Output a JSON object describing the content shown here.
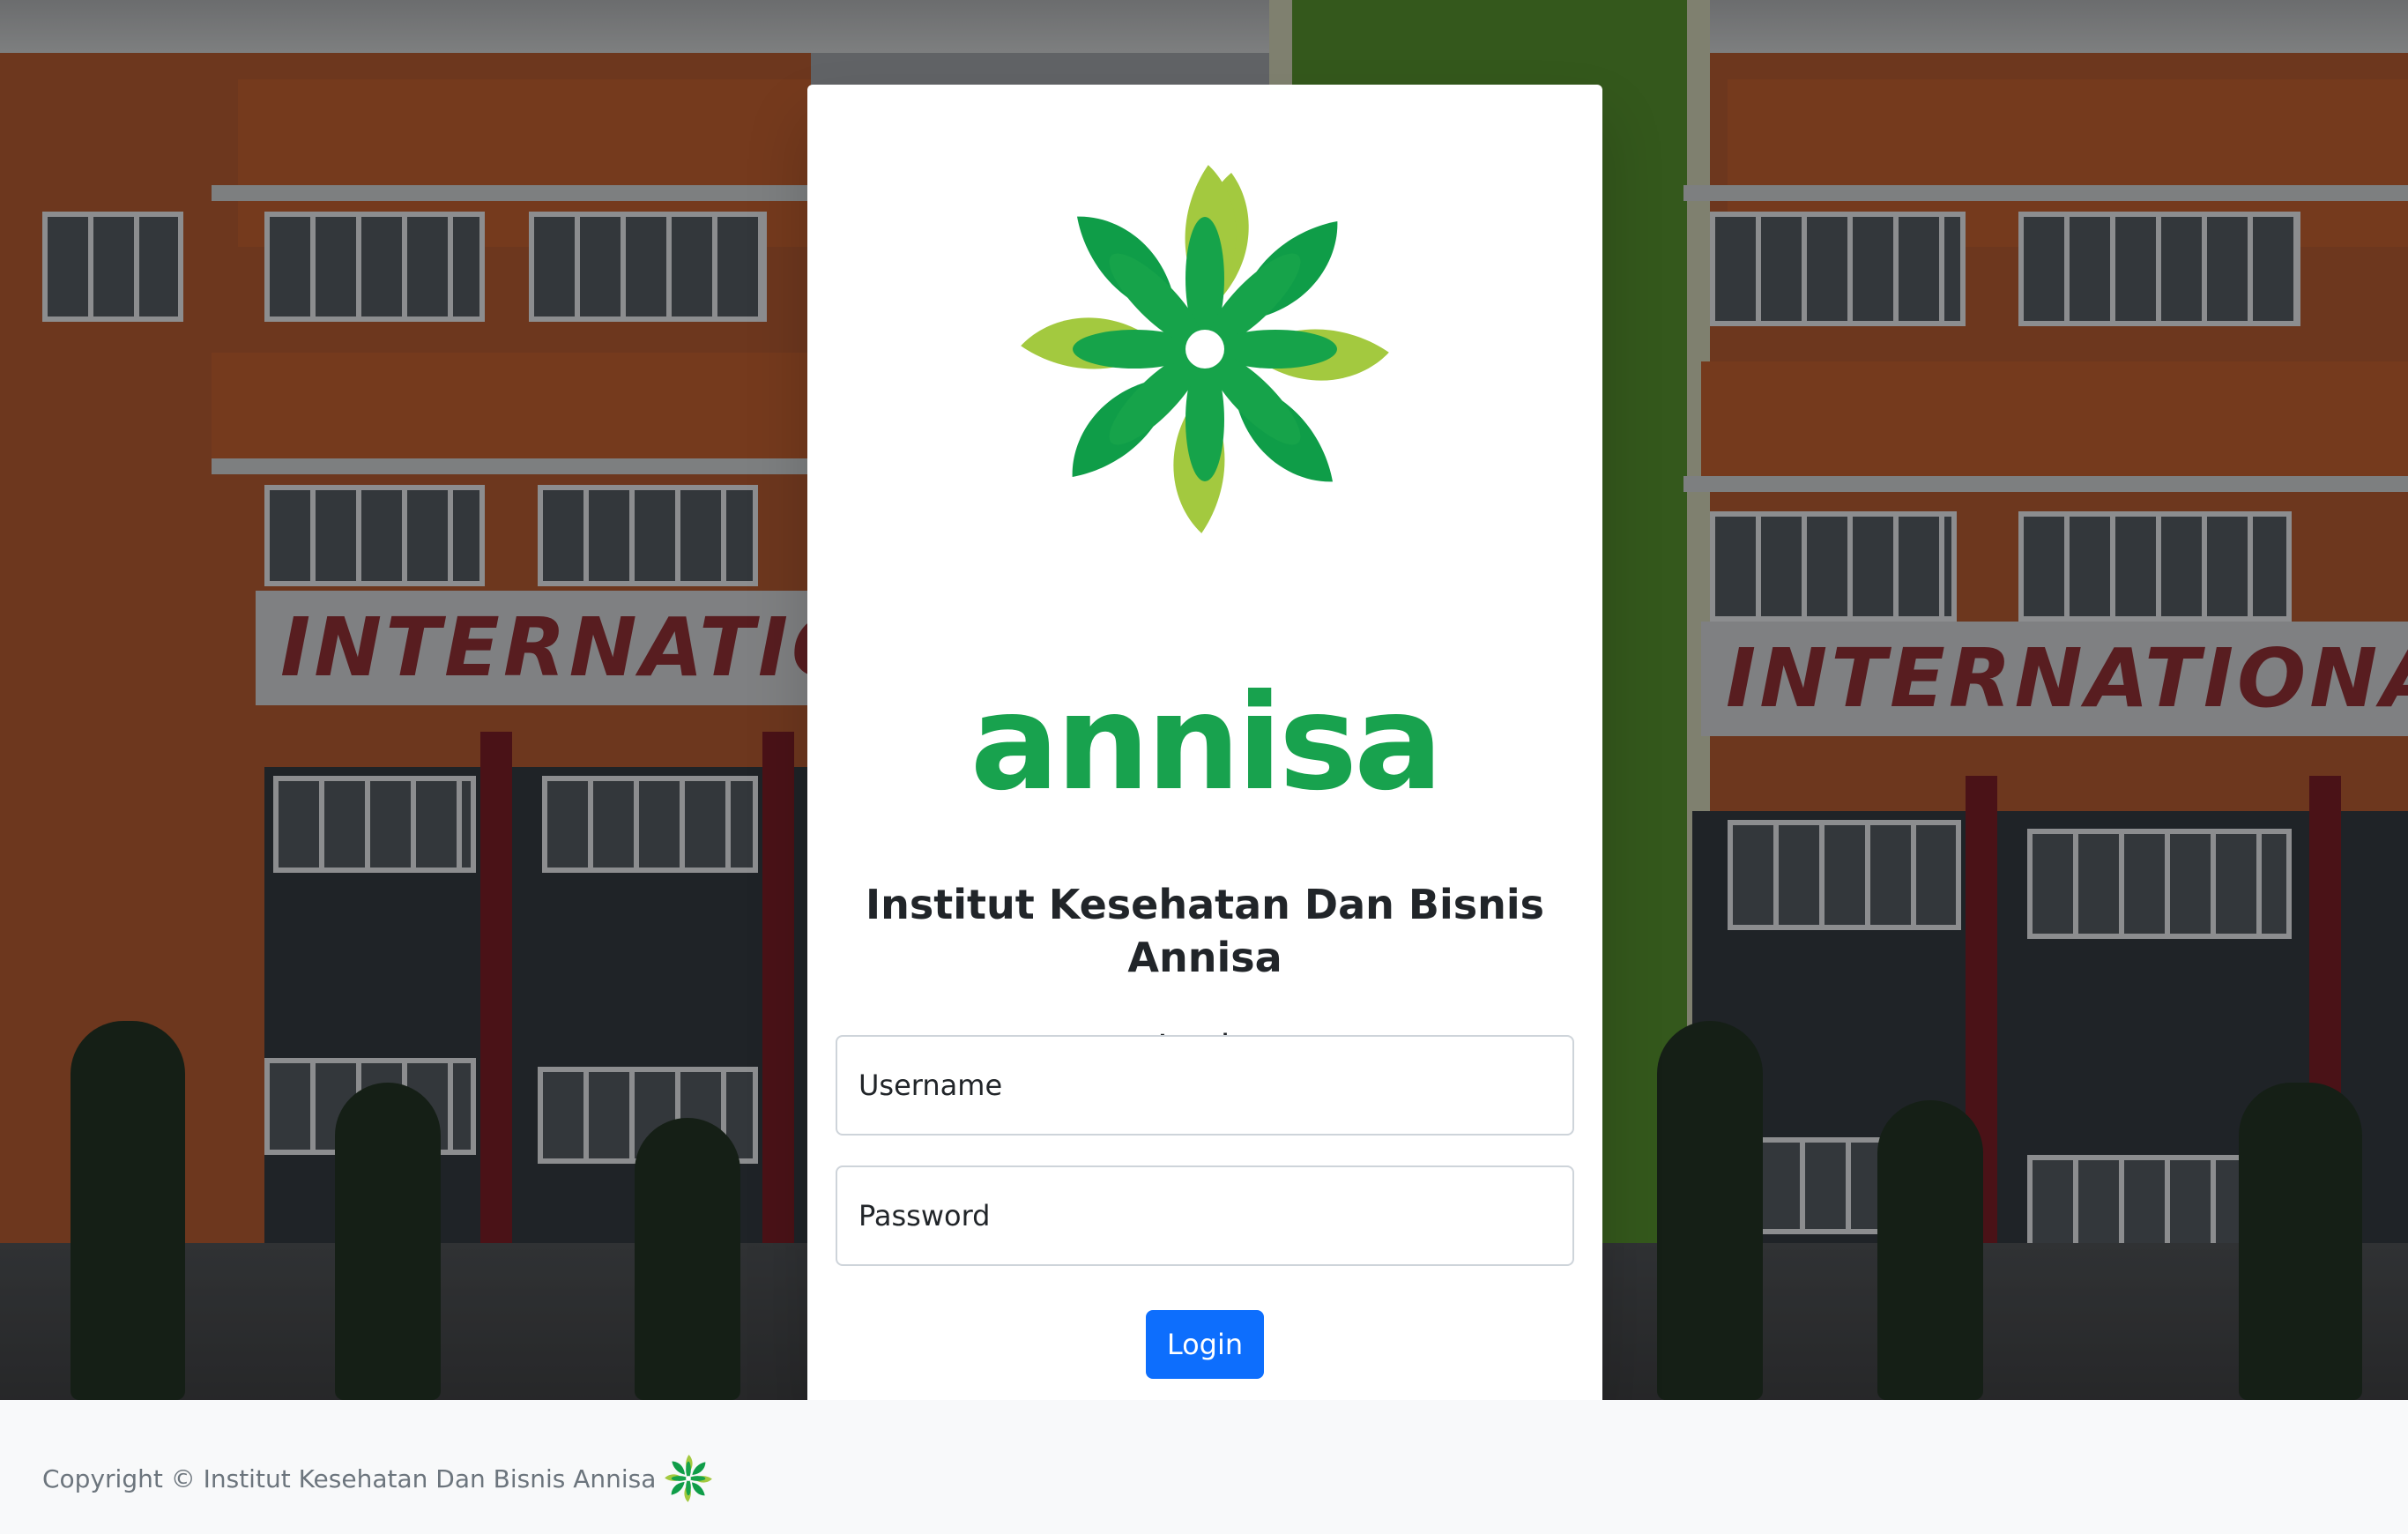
{
  "brand": {
    "wordmark": "annisa",
    "institution_name": "Institut Kesehatan Dan Bisnis Annisa",
    "logo_icon": "annisa-flower-logo",
    "colors": {
      "logo_dark_green": "#0f9d48",
      "logo_light_green": "#a3c93f",
      "wordmark_green": "#18a24e"
    }
  },
  "background": {
    "sign_text": "INTERNATIONAL CU"
  },
  "login_form": {
    "heading": "Login",
    "username_placeholder": "Username",
    "password_placeholder": "Password",
    "username_value": "",
    "password_value": "",
    "submit_label": "Login",
    "submit_color": "#0d6efd"
  },
  "footer": {
    "copyright": "Copyright © Institut Kesehatan Dan Bisnis Annisa",
    "logo_icon": "annisa-flower-logo-small"
  }
}
